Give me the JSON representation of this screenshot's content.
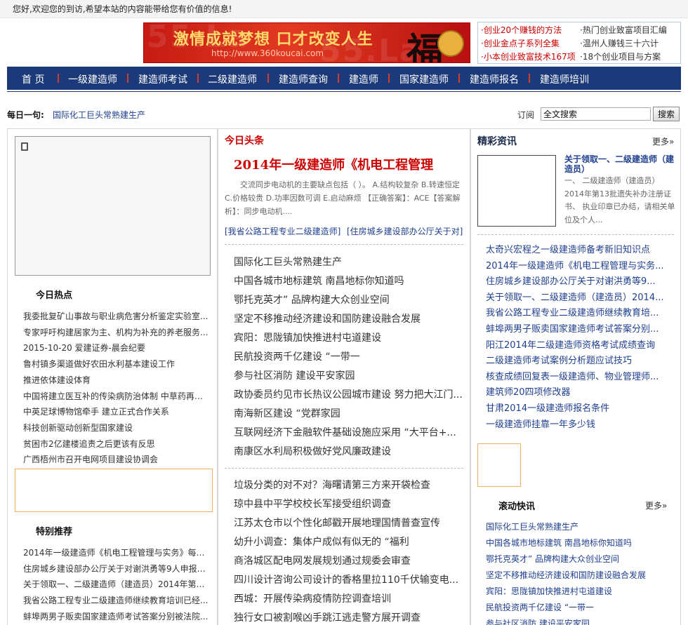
{
  "topbar": {
    "welcome": "您好,欢迎您的到访,希望本站的内容能带给您有价值的信息!"
  },
  "banner": {
    "slogan": "激情成就梦想 口才改变人生",
    "url": "http://www.360koucai.com",
    "bg_text": "55.La",
    "fu_char": "福"
  },
  "quick_links": [
    {
      "text": "·创业20个赚钱的方法",
      "color": "#cc0000"
    },
    {
      "text": "·热门创业致富项目汇编",
      "color": "#333333"
    },
    {
      "text": "·创业金点子系列全集",
      "color": "#cc0000"
    },
    {
      "text": "·温州人赚钱三十六计",
      "color": "#333333"
    },
    {
      "text": "·小本创业致富技术167项",
      "color": "#cc0000"
    },
    {
      "text": "·18个创业项目与方案",
      "color": "#333333"
    }
  ],
  "nav": {
    "items": [
      "首 页",
      "一级建造师",
      "建造师考试",
      "二级建造师",
      "建造师查询",
      "建造师",
      "国家建造师",
      "建造师报名",
      "建造师培训"
    ]
  },
  "daily": {
    "label": "每日一句:",
    "text": "国际化工巨头常熟建生产"
  },
  "search": {
    "subscribe_label": "订阅",
    "value": "全文搜索",
    "button": "搜索"
  },
  "left": {
    "hot_title": "今日热点",
    "hot_items": [
      "我委批复矿山事故与职业病危害分析鉴定实验室...",
      "专家呼吁构建居家为主、机构为补充的养老服务...",
      "2015-10-20 爱建证券-晨会纪要",
      "鲁村镇多渠道做好农田水利基本建设工作",
      "推进依体建设体育",
      "中国将建立医互补的传染病防治体制  中草药再次...",
      "中英足球博物馆牵手  建立正式合作关系",
      "科技创新驱动创新型国家建设",
      "贫困市2亿建楼追责之后更该有反思",
      "广西梧州市召开电网项目建设协调会"
    ],
    "rec_title": "特别推荐",
    "rec_items": [
      "2014年一级建造师《机电工程管理与实务》每日...",
      "住房城乡建设部办公厅关于对谢洪勇等9人申报一...",
      "关于领取一、二级建造师（建造员）2014年第13...",
      "我省公路工程专业二级建造师继续教育培训已经...",
      "蚌埠两男子贩卖国家建造师考试答案分别被法院..."
    ]
  },
  "middle": {
    "headline_label": "今日头条",
    "headline_title": "2014年一级建造师《机电工程管理",
    "headline_summary": "交流同步电动机的主要缺点包括（ ）。 A.结构较复杂 B.转速恒定 C.价格较贵 D.功率因数可调 E.启动麻烦 【正确答案】：ACE【答案解析】：同步电动机....",
    "bracket_links": [
      "[我省公路工程专业二级建造师]",
      "[住房城乡建设部办公厅关于对]"
    ],
    "list1": [
      "国际化工巨头常熟建生产",
      "中国各城市地标建筑 南昌地标你知道吗",
      "鄂托克英才” 品牌构建大众创业空间",
      "坚定不移推动经济建设和国防建设融合发展",
      "宾阳：思陇镇加快推进村屯道建设",
      "民航投资两千亿建设 “一带一",
      "参与社区消防 建设平安家园",
      "政协委员约见市长热议公园城市建设  努力把大江门...",
      "南海新区建设 “党群家园",
      "互联网经济下金融软件基础设施应采用 “大平台+...",
      "南康区水利局积极做好党风廉政建设"
    ],
    "list2": [
      "垃圾分类的对不对？海曙请第三方来开袋检查",
      "琼中县中平学校校长军接受组织调查",
      "江苏太仓市以个性化邮戳开展地理国情普查宣传",
      "幼升小调查：集体户成似有似无的 “福利",
      "商洛城区配电网发展规划通过规委会审查",
      "四川设计咨询公司设计的香格里拉110千伏输变电...",
      "西城：开展传染病疫情防控调查培训",
      "独行女口被割喉凶手跳江逃走警方展开调查"
    ]
  },
  "right": {
    "news_title": "精彩资讯",
    "more": "更多»",
    "feature_title": "关于领取一、二级建造师（建造员）",
    "feature_desc": "一、 二级建造师（建造员）2014年第13批遗失补办注册证书、 执业印章已办结，请相关单位及个人...",
    "news_items": [
      "太奇兴宏程之一级建造师备考新旧知识点",
      "2014年一级建造师《机电工程管理与实务...",
      "住房城乡建设部办公厅关于对谢洪勇等9...",
      "关于领取一、二级建造师（建造员）2014...",
      "我省公路工程专业二级建造师继续教育培...",
      "蚌埠两男子贩卖国家建造师考试答案分别...",
      "阳江2014年二级建造师资格考试成绩查询",
      "二级建造师考试案例分析题应试技巧",
      "核查成绩回复表一级建造师、物业管理师...",
      "建筑师20四项修改器",
      "甘肃2014一级建造师报名条件",
      "一级建造师挂靠一年多少钱"
    ],
    "scroll_title": "滚动快讯",
    "scroll_more": "更多»",
    "scroll_items": [
      "国际化工巨头常熟建生产",
      "中国各城市地标建筑 南昌地标你知道吗",
      "鄂托克英才” 品牌构建大众创业空间",
      "坚定不移推动经济建设和国防建设融合发展",
      "宾阳：思陇镇加快推进村屯道建设",
      "民航投资两千亿建设 “一带一",
      "参与社区消防 建设平安家园"
    ]
  }
}
